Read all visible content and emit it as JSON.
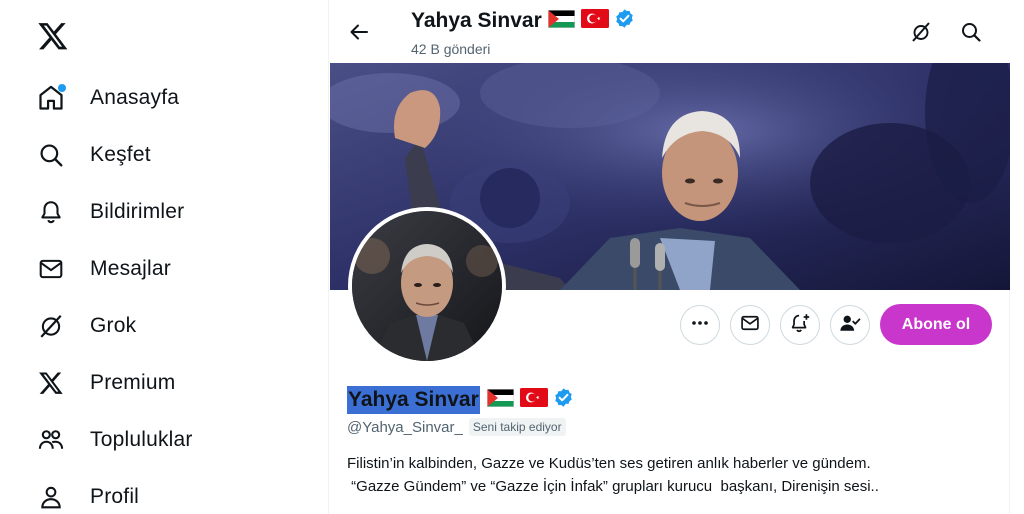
{
  "nav": {
    "logo": "x-logo",
    "items": [
      {
        "label": "Anasayfa",
        "icon": "home-icon",
        "notify": true
      },
      {
        "label": "Keşfet",
        "icon": "search-icon"
      },
      {
        "label": "Bildirimler",
        "icon": "bell-icon"
      },
      {
        "label": "Mesajlar",
        "icon": "envelope-icon"
      },
      {
        "label": "Grok",
        "icon": "grok-icon"
      },
      {
        "label": "Premium",
        "icon": "x-icon"
      },
      {
        "label": "Topluluklar",
        "icon": "people-icon"
      },
      {
        "label": "Profil",
        "icon": "person-icon"
      }
    ]
  },
  "header": {
    "title": "Yahya Sinvar",
    "post_count": "42 B gönderi"
  },
  "profile": {
    "name": "Yahya Sinvar",
    "handle": "@Yahya_Sinvar_",
    "follows_you": "Seni takip ediyor",
    "subscribe_label": "Abone ol",
    "bio_line1": "Filistin’in kalbinden, Gazze ve Kudüs’ten ses getiren anlık haberler ve gündem.",
    "bio_line2": " “Gazze Gündem” ve “Gazze İçin İnfak” grupları kurucu  başkanı, Direnişin sesi.."
  },
  "colors": {
    "accent": "#1d9bf0",
    "subscribe": "#c936cc",
    "selection": "#3c6fd4"
  }
}
